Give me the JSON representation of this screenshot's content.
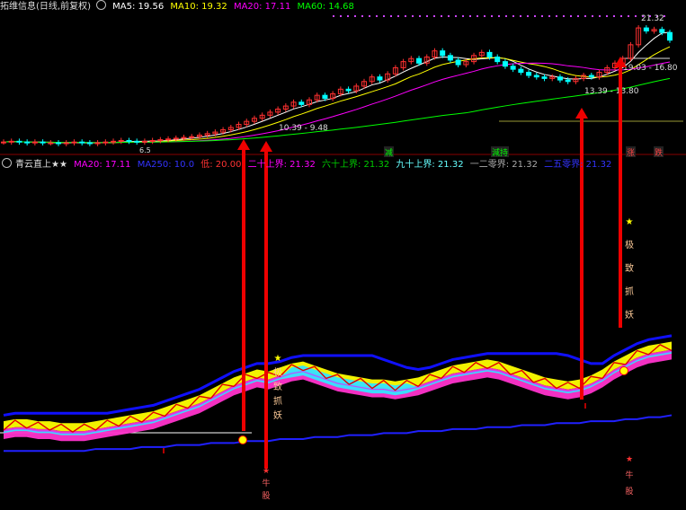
{
  "top_header": {
    "stock_name": "拓维信息(日线,前复权)",
    "ma5_label": "MA5: 19.56",
    "ma10_label": "MA10: 19.32",
    "ma20_label": "MA20: 17.11",
    "ma60_label": "MA60: 14.68",
    "colors": {
      "ma5": "#ffffff",
      "ma10": "#ffff00",
      "ma20": "#ff00ff",
      "ma60": "#00ff00"
    }
  },
  "indicator_header": {
    "name": "青云直上★★",
    "ma20_label": "MA20: 17.11",
    "ma250_label": "MA250: 10.0",
    "low_label": "低: 20.00",
    "twenty_up_label": "二十上界: 21.32",
    "sixty_up_label": "六十上界: 21.32",
    "ninety_up_label": "九十上界: 21.32",
    "one_two_label": "一二零界: 21.32",
    "twofifty_label": "二五零界: 21.32"
  },
  "price_annotations": {
    "high": "21.32",
    "range1": "19.03 - 16.80",
    "range2": "13.39 - 13.80",
    "range3": "10.39 - 9.48",
    "low_tag": "6.5"
  },
  "event_tags": [
    "减",
    "減持",
    "涨",
    "跌"
  ],
  "signal_text": [
    "★",
    "极",
    "致",
    "抓",
    "妖"
  ],
  "bottom_text": [
    "★",
    "牛",
    "股"
  ],
  "chart_data": [
    {
      "type": "candlestick",
      "title": "",
      "close": [
        6.3,
        6.4,
        6.3,
        6.2,
        6.3,
        6.2,
        6.2,
        6.1,
        6.2,
        6.3,
        6.2,
        6.1,
        6.2,
        6.3,
        6.4,
        6.5,
        6.4,
        6.3,
        6.4,
        6.5,
        6.6,
        6.7,
        6.8,
        6.9,
        7.0,
        7.2,
        7.4,
        7.6,
        7.9,
        8.2,
        8.6,
        9.0,
        9.4,
        9.8,
        10.2,
        10.6,
        11.0,
        11.5,
        11.2,
        11.8,
        12.4,
        12.0,
        12.6,
        13.2,
        13.0,
        13.6,
        14.2,
        14.8,
        14.4,
        15.2,
        16.0,
        16.8,
        17.2,
        16.6,
        17.4,
        18.2,
        17.6,
        17.0,
        16.4,
        16.8,
        17.6,
        18.0,
        17.4,
        16.8,
        16.2,
        15.8,
        15.4,
        15.0,
        14.8,
        14.6,
        14.8,
        14.4,
        14.2,
        14.6,
        15.0,
        14.8,
        15.4,
        16.0,
        16.6,
        17.2,
        19.0,
        21.2,
        20.8,
        21.0,
        20.6,
        19.6
      ],
      "ma_lines": [
        "MA5",
        "MA10",
        "MA20",
        "MA60"
      ],
      "high_marker": "21.32",
      "low_marker": "6.5"
    },
    {
      "type": "line",
      "title": "青云直上★★",
      "series": [
        {
          "name": "MA20",
          "values": [
            20,
            21,
            21,
            20,
            20,
            19,
            19,
            19,
            20,
            21,
            22,
            23,
            24,
            25,
            27,
            29,
            31,
            33,
            36,
            39,
            42,
            44,
            46,
            45,
            47,
            49,
            50,
            48,
            46,
            44,
            43,
            42,
            41,
            41,
            40,
            41,
            42,
            44,
            46,
            48,
            49,
            50,
            51,
            50,
            48,
            46,
            44,
            42,
            41,
            40,
            41,
            43,
            46,
            50,
            53,
            56,
            58,
            59,
            60
          ]
        },
        {
          "name": "MA250",
          "values": [
            8,
            8,
            8,
            8,
            8,
            8,
            8,
            8,
            9,
            9,
            9,
            9,
            10,
            10,
            10,
            11,
            11,
            11,
            12,
            12,
            12,
            13,
            13,
            13,
            14,
            14,
            14,
            15,
            15,
            15,
            16,
            16,
            16,
            17,
            17,
            17,
            18,
            18,
            18,
            19,
            19,
            19,
            20,
            20,
            20,
            21,
            21,
            21,
            22,
            22,
            22,
            23,
            23,
            23,
            24,
            24,
            25,
            25,
            26
          ]
        }
      ]
    }
  ]
}
